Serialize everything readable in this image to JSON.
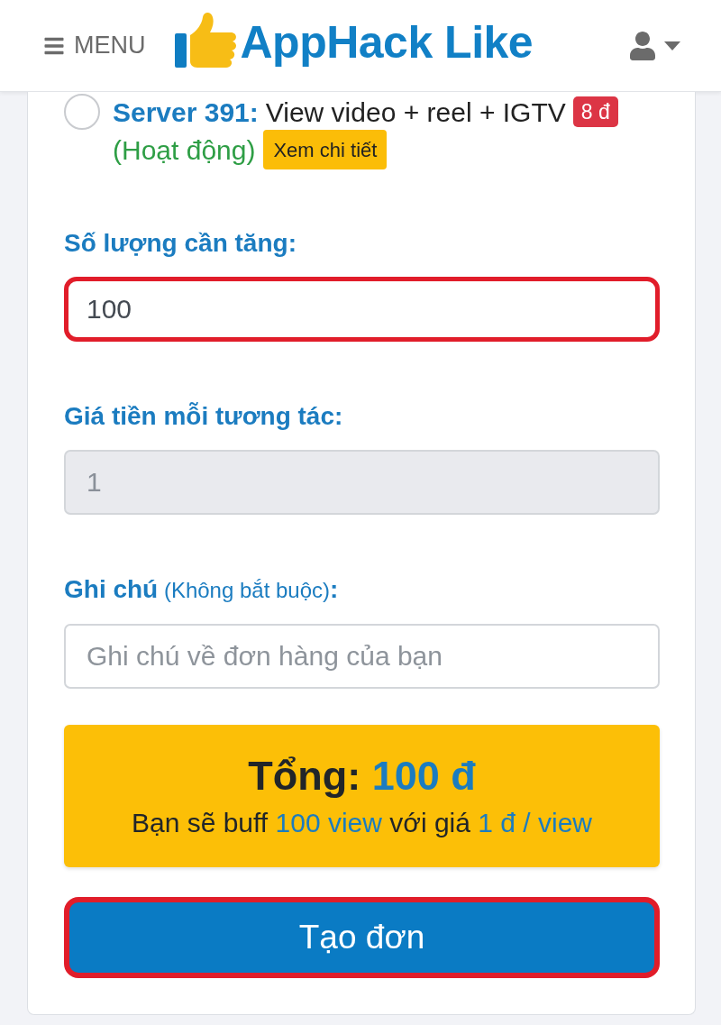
{
  "header": {
    "menu_label": "MENU",
    "logo": "AppHack Like"
  },
  "server_option": {
    "selected": false,
    "name": "Server 391:",
    "description": "View video + reel + IGTV",
    "price_badge": "8 đ",
    "status": "(Hoạt động)",
    "details_button": "Xem chi tiết"
  },
  "fields": [
    {
      "label": "Số lượng cần tăng:",
      "value": "100",
      "highlighted": true,
      "disabled": false
    },
    {
      "label": "Giá tiền mỗi tương tác:",
      "value": "1",
      "highlighted": false,
      "disabled": true
    },
    {
      "label": "Ghi chú",
      "note": "(Không bắt buộc)",
      "label_suffix": ":",
      "placeholder": "Ghi chú về đơn hàng của bạn",
      "highlighted": false,
      "disabled": false
    }
  ],
  "total": {
    "label": "Tổng:",
    "amount": "100 đ",
    "summary": {
      "lead": "Bạn sẽ buff",
      "quantity": "100 view",
      "connector": "với giá",
      "unit_price": "1 đ / view"
    }
  },
  "submit_button": {
    "label": "Tạo đơn",
    "highlighted": true
  }
}
